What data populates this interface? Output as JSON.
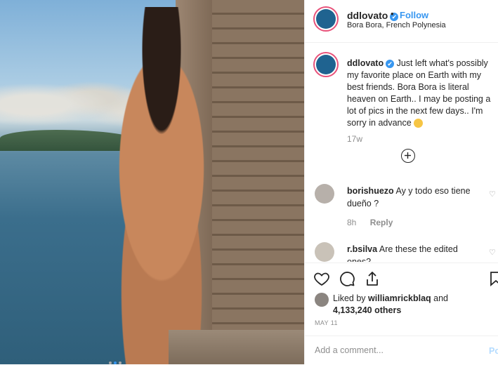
{
  "post": {
    "username": "ddlovato",
    "verified_glyph": "✔",
    "separator": "•",
    "follow_label": "Follow",
    "location": "Bora Bora, French Polynesia",
    "caption": "Just left what's possibly my favorite place on Earth with my best friends. Bora Bora is literal heaven on Earth.. I may be posting a lot of pics in the next few days.. I'm sorry in advance",
    "caption_time": "17w",
    "load_more_icon": "plus-circle-icon",
    "comments": [
      {
        "username": "borishuezo",
        "text": "Ay y todo eso tiene dueño ?",
        "time": "8h",
        "reply_label": "Reply"
      },
      {
        "username": "r.bsilva",
        "text": "Are these the edited ones?"
      }
    ],
    "likes": {
      "prefix": "Liked by",
      "user": "williamrickblaq",
      "middle": "and",
      "count": "4,133,240 others"
    },
    "date": "MAY 11",
    "add_comment_placeholder": "Add a comment...",
    "post_label": "Post",
    "carousel": {
      "count": 3,
      "active_index": 1
    },
    "colors": {
      "accent": "#3897f0",
      "story_ring": "#e8527a",
      "avatar": "#1f6390"
    }
  }
}
